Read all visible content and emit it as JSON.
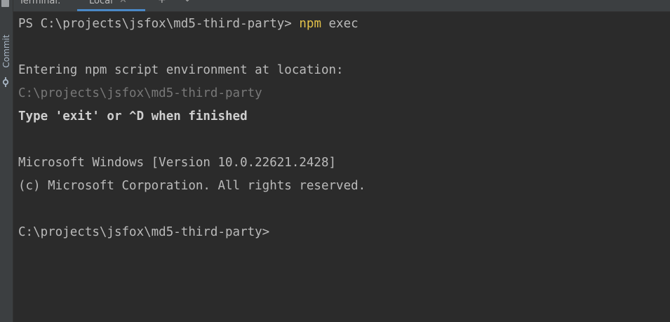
{
  "tabbar": {
    "title": "Terminal:",
    "tabs": [
      {
        "label": "Local",
        "active": true
      }
    ],
    "close_symbol": "✕",
    "add_symbol": "+",
    "dropdown_symbol": "⌄"
  },
  "sidebar": {
    "commit_label": "Commit",
    "icons": [
      "project-icon",
      "commit-icon"
    ]
  },
  "terminal": {
    "prompt_line": {
      "prompt": "PS C:\\projects\\jsfox\\md5-third-party> ",
      "command": "npm",
      "args": " exec"
    },
    "entering": "Entering npm script environment at location:",
    "location": "C:\\projects\\jsfox\\md5-third-party",
    "exit_hint": "Type 'exit' or ^D when finished",
    "windows_version": "Microsoft Windows [Version 10.0.22621.2428]",
    "copyright": "(c) Microsoft Corporation. All rights reserved.",
    "final_prompt": "C:\\projects\\jsfox\\md5-third-party>"
  },
  "colors": {
    "background": "#2b2b2b",
    "text": "#bbbbbb",
    "dim_text": "#787878",
    "command_highlight": "#e3c24a",
    "tab_underline": "#4a88c7"
  }
}
